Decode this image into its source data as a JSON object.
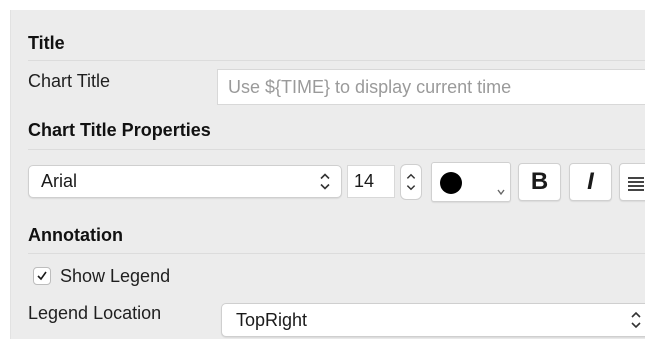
{
  "title_section": {
    "heading": "Title",
    "chart_title_label": "Chart Title",
    "chart_title_placeholder": "Use ${TIME} to display current time"
  },
  "properties_section": {
    "heading": "Chart Title Properties",
    "font_family": "Arial",
    "font_size": "14",
    "color": "#000000",
    "bold_label": "B",
    "italic_label": "I",
    "align_icon": "align-text-icon"
  },
  "annotation_section": {
    "heading": "Annotation",
    "show_legend_label": "Show Legend",
    "show_legend_checked": true,
    "legend_location_label": "Legend Location",
    "legend_location_value": "TopRight"
  }
}
